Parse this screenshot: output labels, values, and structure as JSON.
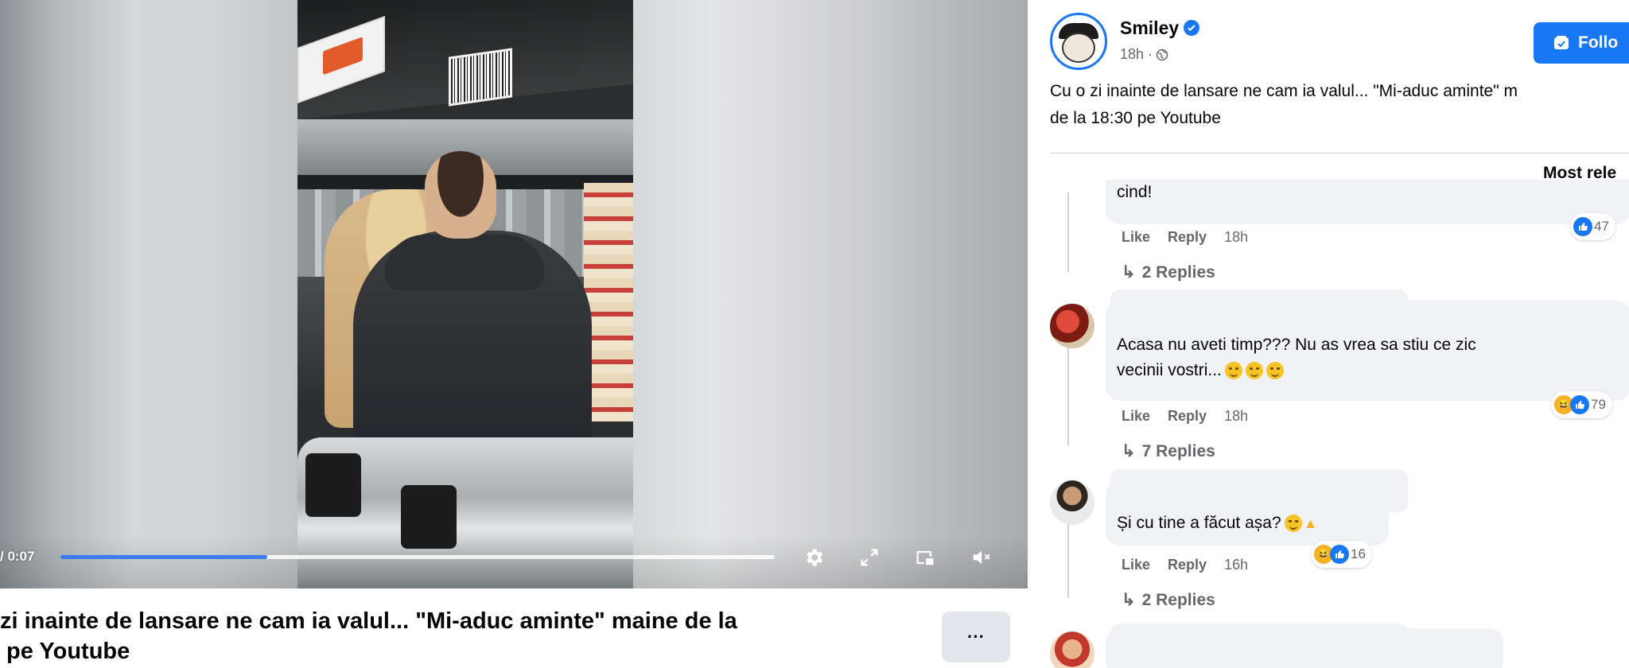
{
  "video": {
    "time_display": "/ 0:07",
    "progress_fraction": 0.29,
    "controls": {
      "settings_icon": "gear-icon",
      "fullscreen_icon": "expand-icon",
      "miniplayer_icon": "picture-in-picture-icon",
      "volume_icon": "muted-speaker-icon"
    },
    "accent_color": "#3b7cf1"
  },
  "caption": {
    "line1": "zi inainte de lansare ne cam ia valul... \"Mi-aduc aminte\" maine de la",
    "line2": " pe Youtube",
    "more_label": "···"
  },
  "post": {
    "page_name": "Smiley",
    "time": "18h ·",
    "text_line1": "Cu o zi inainte de lansare ne cam ia valul... \"Mi-aduc aminte\" m",
    "text_line2": "de la 18:30 pe Youtube",
    "follow_label": "Follo",
    "sort_label": "Most rele"
  },
  "comments": [
    {
      "text": "cind!",
      "like_label": "Like",
      "reply_label": "Reply",
      "time": "18h",
      "reaction_count": "47",
      "replies_label": "2 Replies"
    },
    {
      "text_line1": "Acasa nu aveti timp??? Nu as vrea sa stiu ce zic",
      "text_line2": "vecinii vostri...",
      "like_label": "Like",
      "reply_label": "Reply",
      "time": "18h",
      "reaction_count": "79",
      "replies_label": "7 Replies"
    },
    {
      "text": "Și cu tine a făcut așa?",
      "like_label": "Like",
      "reply_label": "Reply",
      "time": "16h",
      "reaction_count": "16",
      "replies_label": "2 Replies"
    }
  ],
  "colors": {
    "facebook_blue": "#1877f2",
    "bubble_bg": "#f0f2f5",
    "secondary_text": "#65676b"
  }
}
